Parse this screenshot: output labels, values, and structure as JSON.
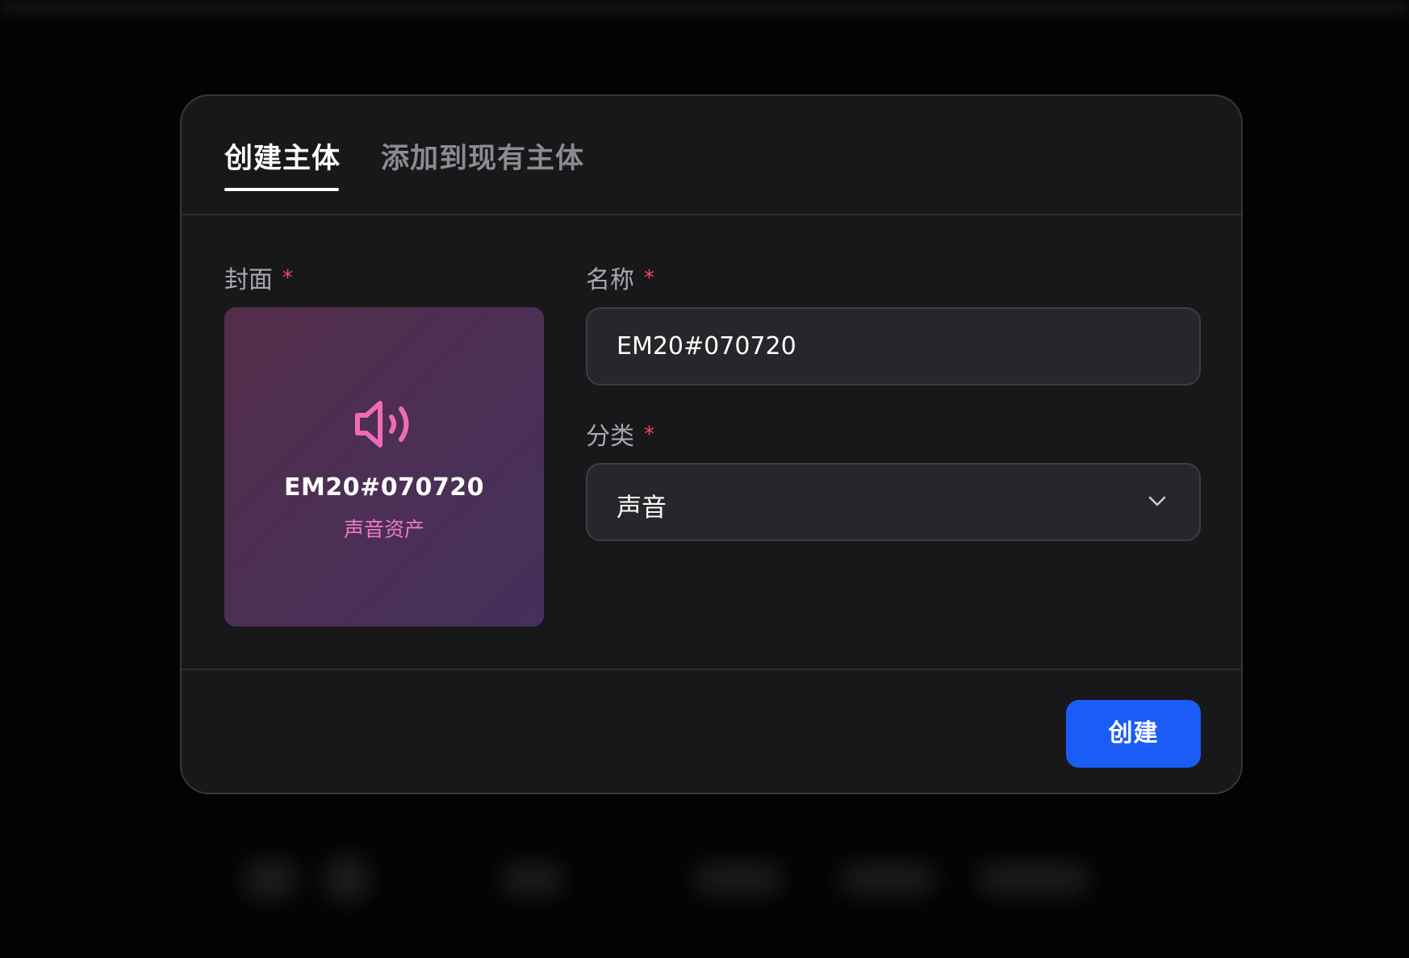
{
  "dialog": {
    "tabs": [
      {
        "label": "创建主体",
        "active": true
      },
      {
        "label": "添加到现有主体",
        "active": false
      }
    ],
    "cover": {
      "label": "封面",
      "required_mark": "*",
      "icon": "speaker-volume-icon",
      "title": "EM20#070720",
      "subtitle": "声音资产",
      "icon_color": "#f06ab8"
    },
    "name_field": {
      "label": "名称",
      "required_mark": "*",
      "value": "EM20#070720"
    },
    "category_field": {
      "label": "分类",
      "required_mark": "*",
      "value": "声音",
      "icon": "chevron-down-icon"
    },
    "create_button": {
      "label": "创建",
      "color": "#1b5cf7"
    }
  }
}
